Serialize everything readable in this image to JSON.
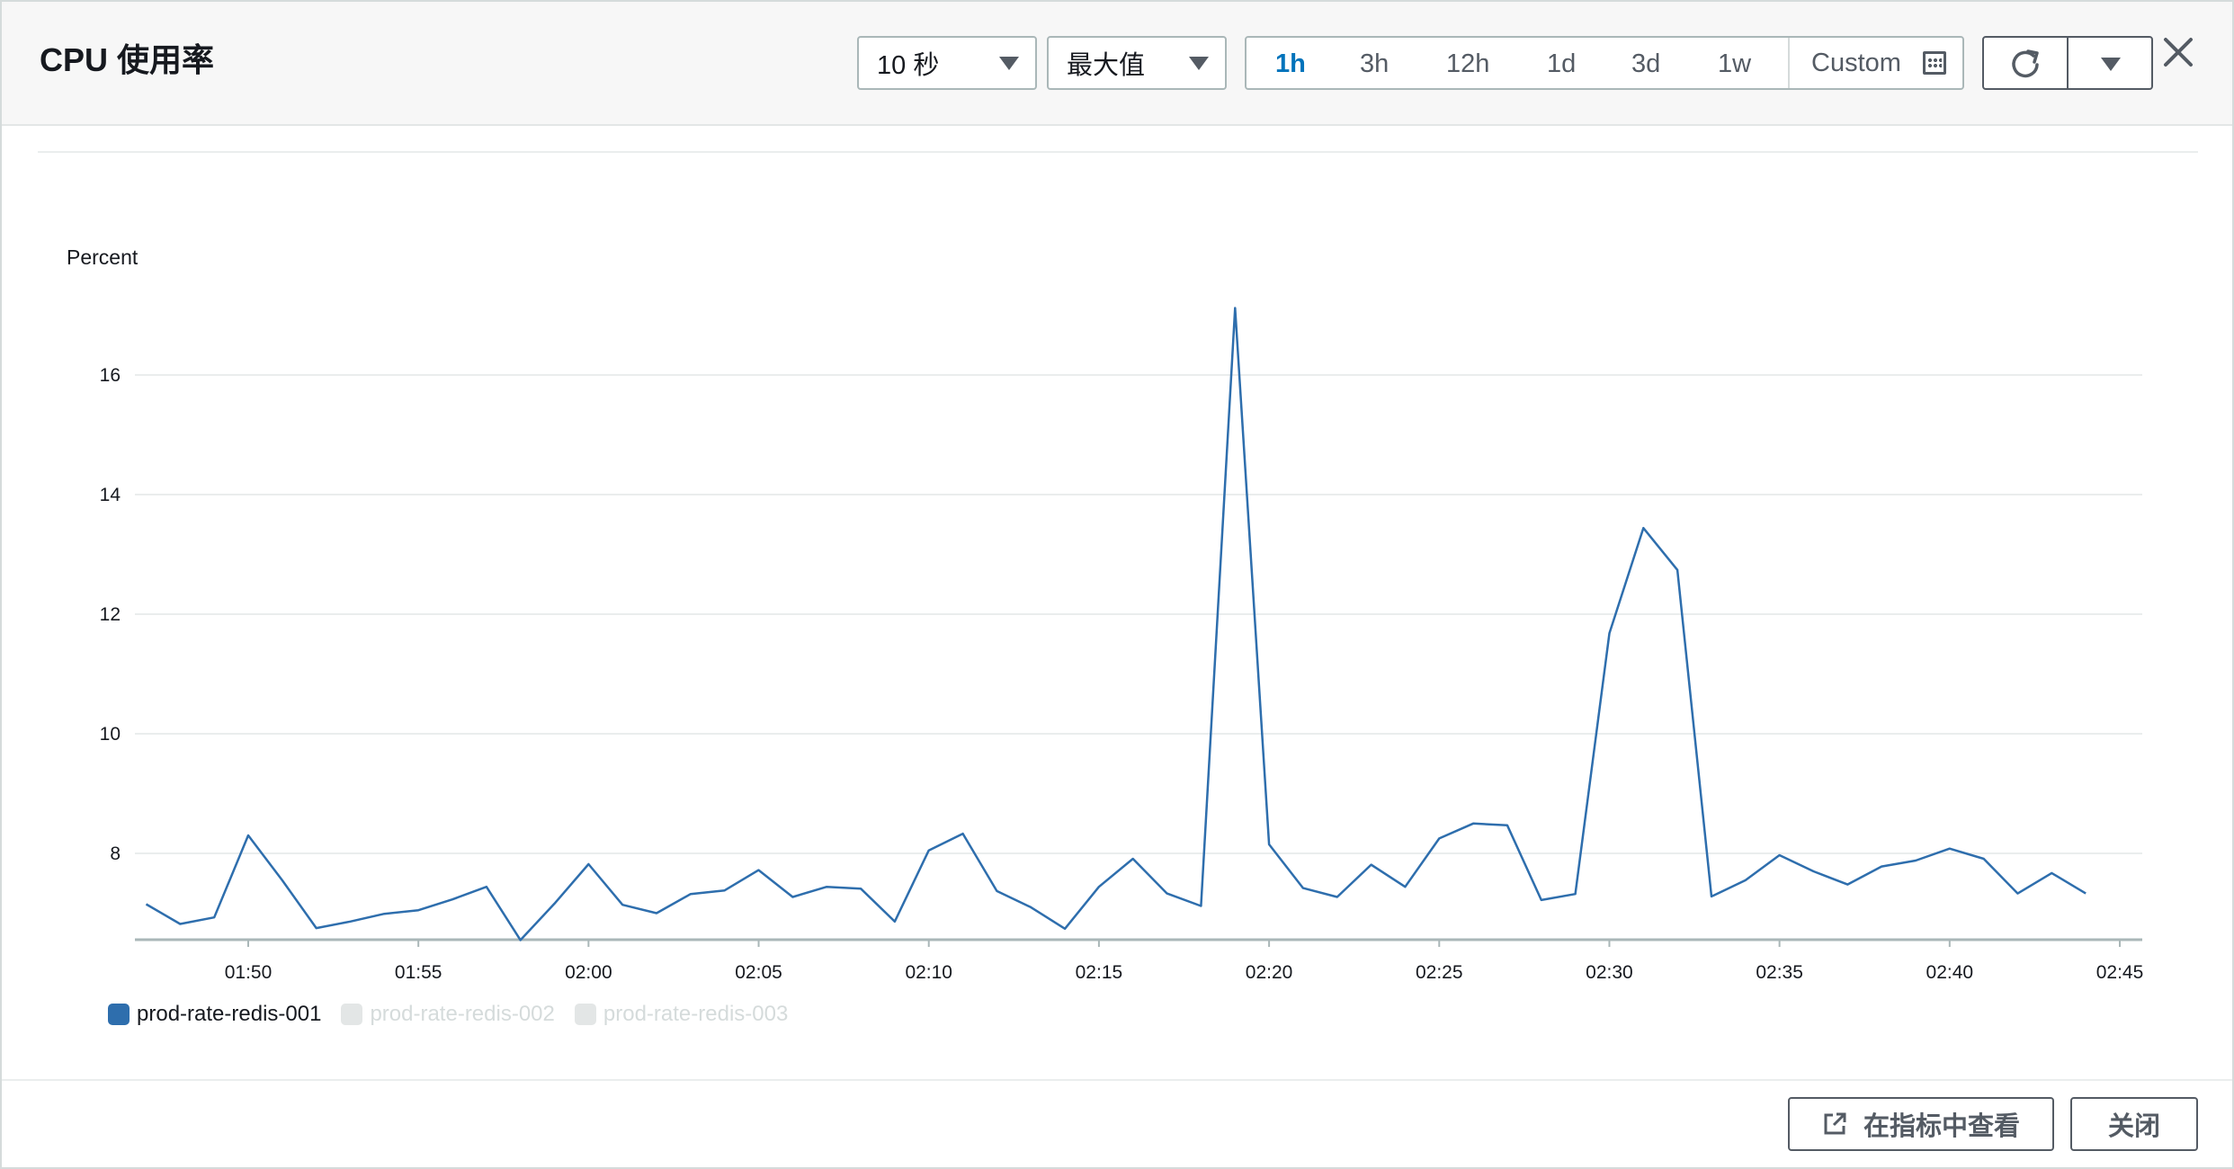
{
  "header": {
    "title": "CPU 使用率",
    "period_select": "10 秒",
    "statistic_select": "最大值",
    "time_ranges": [
      "1h",
      "3h",
      "12h",
      "1d",
      "3d",
      "1w"
    ],
    "active_range": "1h",
    "custom_label": "Custom"
  },
  "footer": {
    "view_in_metrics": "在指标中查看",
    "close": "关闭"
  },
  "colors": {
    "series": "#2e6ead",
    "active": "#0073bb",
    "inactive_legend": "#d5dbdb"
  },
  "chart_data": {
    "type": "line",
    "ylabel": "Percent",
    "ylim": [
      6.5,
      17.5
    ],
    "yticks": [
      8,
      10,
      12,
      16,
      14
    ],
    "x_ticks": [
      "01:50",
      "01:55",
      "02:00",
      "02:05",
      "02:10",
      "02:15",
      "02:20",
      "02:25",
      "02:30",
      "02:35",
      "02:40",
      "02:45"
    ],
    "grid": true,
    "legend_position": "bottom-left",
    "series": [
      {
        "name": "prod-rate-redis-001",
        "active": true,
        "x": [
          "01:47",
          "01:48",
          "01:49",
          "01:50",
          "01:51",
          "01:52",
          "01:53",
          "01:54",
          "01:55",
          "01:56",
          "01:57",
          "01:58",
          "01:59",
          "02:00",
          "02:01",
          "02:02",
          "02:03",
          "02:04",
          "02:05",
          "02:06",
          "02:07",
          "02:08",
          "02:09",
          "02:10",
          "02:11",
          "02:12",
          "02:13",
          "02:14",
          "02:15",
          "02:16",
          "02:17",
          "02:18",
          "02:19",
          "02:20",
          "02:21",
          "02:22",
          "02:23",
          "02:24",
          "02:25",
          "02:26",
          "02:27",
          "02:28",
          "02:29",
          "02:30",
          "02:31",
          "02:32",
          "02:33",
          "02:34",
          "02:35",
          "02:36",
          "02:37",
          "02:38",
          "02:39",
          "02:40",
          "02:41",
          "02:42",
          "02:43",
          "02:44"
        ],
        "values": [
          7.15,
          6.82,
          6.93,
          8.3,
          7.55,
          6.75,
          6.86,
          6.99,
          7.05,
          7.23,
          7.44,
          6.55,
          7.16,
          7.82,
          7.14,
          7.0,
          7.32,
          7.38,
          7.72,
          7.27,
          7.44,
          7.41,
          6.86,
          8.05,
          8.33,
          7.37,
          7.1,
          6.74,
          7.44,
          7.91,
          7.33,
          7.12,
          17.12,
          8.15,
          7.42,
          7.27,
          7.81,
          7.44,
          8.25,
          8.5,
          8.47,
          7.22,
          7.32,
          11.68,
          13.44,
          12.74,
          7.28,
          7.55,
          7.97,
          7.7,
          7.48,
          7.78,
          7.88,
          8.08,
          7.91,
          7.33,
          7.67,
          7.33
        ]
      },
      {
        "name": "prod-rate-redis-002",
        "active": false
      },
      {
        "name": "prod-rate-redis-003",
        "active": false
      }
    ]
  }
}
